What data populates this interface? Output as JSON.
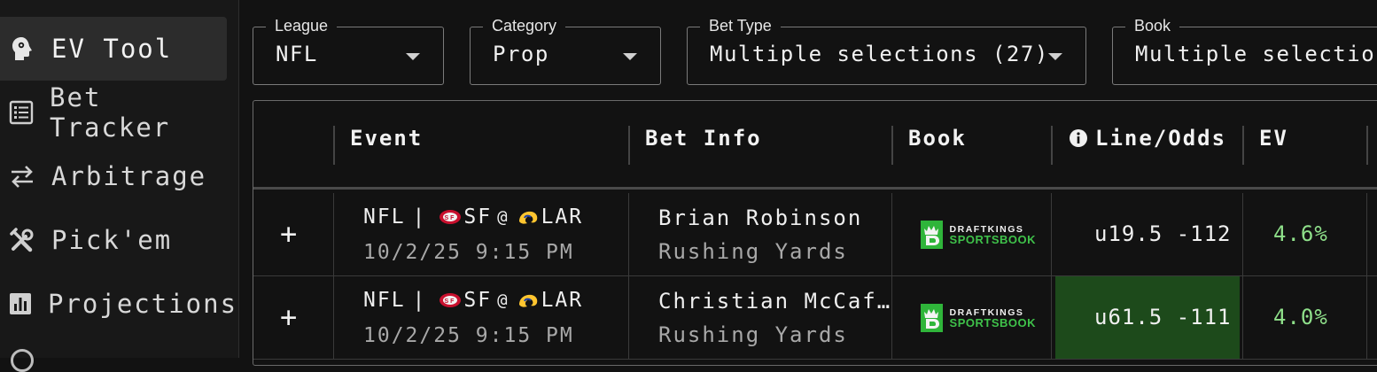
{
  "sidebar": {
    "items": [
      {
        "label": "EV Tool",
        "icon": "brain-head-icon",
        "active": true
      },
      {
        "label": "Bet Tracker",
        "icon": "list-icon",
        "active": false
      },
      {
        "label": "Arbitrage",
        "icon": "swap-arrows-icon",
        "active": false
      },
      {
        "label": "Pick'em",
        "icon": "tools-icon",
        "active": false
      },
      {
        "label": "Projections",
        "icon": "bar-chart-icon",
        "active": false
      }
    ]
  },
  "filters": {
    "league": {
      "label": "League",
      "value": "NFL"
    },
    "category": {
      "label": "Category",
      "value": "Prop"
    },
    "bet_type": {
      "label": "Bet Type",
      "value": "Multiple selections (27)"
    },
    "book": {
      "label": "Book",
      "value": "Multiple selections"
    }
  },
  "table": {
    "headers": {
      "event": "Event",
      "bet_info": "Bet Info",
      "book": "Book",
      "line_odds": "Line/Odds",
      "ev": "EV"
    },
    "rows": [
      {
        "expand": "+",
        "league": "NFL",
        "sep": "|",
        "away": "SF",
        "at": "@",
        "home": "LAR",
        "datetime": "10/2/25 9:15 PM",
        "player": "Brian Robinson",
        "market": "Rushing Yards",
        "book_line1": "DRAFTKINGS",
        "book_line2": "SPORTSBOOK",
        "line": "u19.5",
        "odds": "-112",
        "ev": "4.6%",
        "highlight": false
      },
      {
        "expand": "+",
        "league": "NFL",
        "sep": "|",
        "away": "SF",
        "at": "@",
        "home": "LAR",
        "datetime": "10/2/25 9:15 PM",
        "player": "Christian McCaf…",
        "market": "Rushing Yards",
        "book_line1": "DRAFTKINGS",
        "book_line2": "SPORTSBOOK",
        "line": "u61.5",
        "odds": "-111",
        "ev": "4.0%",
        "highlight": true
      }
    ]
  },
  "colors": {
    "positive_ev": "#8fe08a",
    "highlight_cell": "#1d4a1b",
    "draftkings_green": "#2fb53a"
  }
}
